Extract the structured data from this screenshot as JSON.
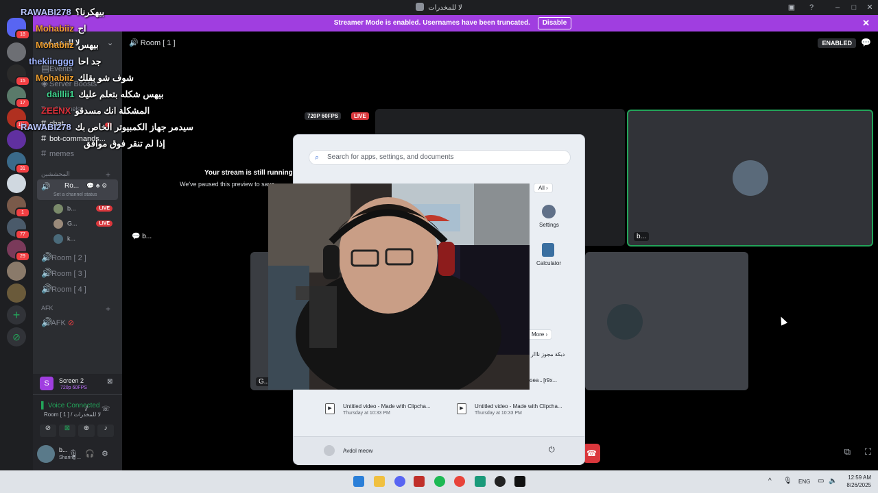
{
  "window": {
    "title": "لا للمخدرات"
  },
  "banner": {
    "text": "Streamer Mode is enabled. Usernames have been truncated.",
    "button": "Disable",
    "close": "✕"
  },
  "rail": {
    "badges": [
      "18",
      "15",
      "17",
      "1K+",
      "31",
      "1",
      "77",
      "29"
    ]
  },
  "overlay_chat": [
    {
      "name": "RAWABI278",
      "msg": "بيهكرنا؟",
      "color": "#b9c6ff"
    },
    {
      "name": "Mohabiiz",
      "msg": "اح",
      "color": "#f0a030"
    },
    {
      "name": "Mohabiiz",
      "msg": "بيهس",
      "color": "#f0a030"
    },
    {
      "name": "thekiinggg",
      "msg": "جد احا",
      "color": "#9fb4ff"
    },
    {
      "name": "Mohabiiz",
      "msg": "شوف شو بقلك",
      "color": "#f0a030"
    },
    {
      "name": "daillii1",
      "msg": "بيهس شكله بتعلم عليك",
      "color": "#40d890"
    },
    {
      "name": "ZEENX",
      "msg": "المشكلة انك مسدقو",
      "color": "#e0303a"
    },
    {
      "name": "RAWABI278",
      "msg": "سيدمر جهاز الكمبيوتر الخاص بك",
      "color": "#b9c6ff"
    },
    {
      "name": "",
      "msg": "إذا لم تنقر فوق موافق",
      "color": "#ffffff"
    }
  ],
  "sidebar": {
    "server_name": "لا للمخدرات",
    "events": "Events",
    "boosts": "Server Boosts",
    "text_channels_header": "Text Channels",
    "text_channels": [
      "chat",
      "bot-commands...",
      "memes"
    ],
    "chat_badge": "1",
    "voice_header": "المحششين",
    "active_room": "Ro...",
    "channel_status": "Set a channel status",
    "room_users": [
      {
        "name": "b...",
        "live": "LIVE"
      },
      {
        "name": "G...",
        "live": "LIVE"
      },
      {
        "name": "k...",
        "live": ""
      }
    ],
    "rooms": [
      "Room [ 2 ]",
      "Room [ 3 ]",
      "Room [ 4 ]"
    ],
    "afk_header": "AFK",
    "afk_channel": "AFK"
  },
  "bottom_panel": {
    "screen_name": "Screen 2",
    "screen_sub": "720p 60FPS",
    "voice_status": "Voice Connected",
    "voice_room": "Room [ 1 ] / لا للمخدرات",
    "user_name": "b...",
    "user_status": "Sharing ..."
  },
  "main": {
    "room_title": "Room [ 1 ]",
    "enabled": "ENABLED",
    "stream_badge": "720P 60FPS",
    "live": "LIVE",
    "paused_title": "Your stream is still running!",
    "paused_sub": "We've paused this preview to save",
    "tile_names": [
      "b...",
      "b...",
      "G..."
    ]
  },
  "start_menu": {
    "search_placeholder": "Search for apps, settings, and documents",
    "all": "All",
    "apps": [
      "Settings",
      "Calculator"
    ],
    "more": "More",
    "recommended_right": [
      "دبكة مجوز نااار",
      "oea ـ [r9x..."
    ],
    "recent": [
      {
        "title": "Untitled video - Made with Clipcha...",
        "sub": "Thursday at 10:33 PM"
      },
      {
        "title": "Untitled video - Made with Clipcha...",
        "sub": "Thursday at 10:33 PM"
      }
    ],
    "user": "Avdol meow"
  },
  "taskbar": {
    "lang": "ENG",
    "time": "12:59 AM",
    "date": "8/26/2025"
  }
}
